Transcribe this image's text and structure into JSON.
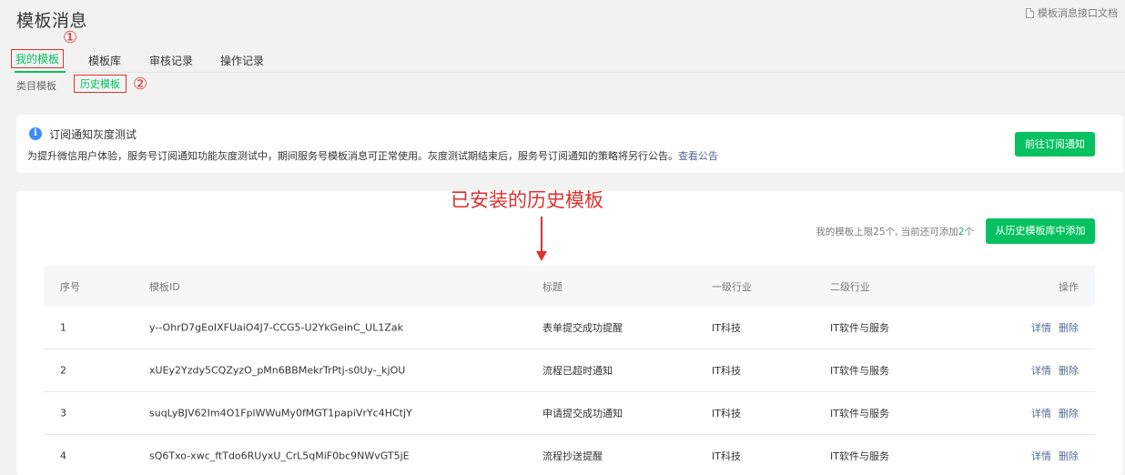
{
  "page_title": "模板消息",
  "doc_link": "模板消息接口文档",
  "tabs": [
    "我的模板",
    "模板库",
    "审核记录",
    "操作记录"
  ],
  "subtabs": [
    "类目模板",
    "历史模板"
  ],
  "markers": [
    "①",
    "②"
  ],
  "notice": {
    "title": "订阅通知灰度测试",
    "desc": "为提升微信用户体验，服务号订阅通知功能灰度测试中，期间服务号模板消息可正常使用。灰度测试期结束后，服务号订阅通知的策略将另行公告。",
    "link": "查看公告",
    "button": "前往订阅通知"
  },
  "annotation": "已安装的历史模板",
  "limit": {
    "prefix": "我的模板上限25个, 当前还可添加",
    "count": "2",
    "suffix": "个"
  },
  "add_button": "从历史模板库中添加",
  "table": {
    "headers": [
      "序号",
      "模板ID",
      "标题",
      "一级行业",
      "二级行业",
      "操作"
    ],
    "rows": [
      {
        "no": "1",
        "id": "y--OhrD7gEoIXFUaiO4J7-CCG5-U2YkGeinC_UL1Zak",
        "title": "表单提交成功提醒",
        "ind1": "IT科技",
        "ind2": "IT软件与服务"
      },
      {
        "no": "2",
        "id": "xUEy2Yzdy5CQZyzO_pMn6BBMekrTrPtj-s0Uy-_kjOU",
        "title": "流程已超时通知",
        "ind1": "IT科技",
        "ind2": "IT软件与服务"
      },
      {
        "no": "3",
        "id": "suqLyBJV62Im4O1FplWWuMy0fMGT1papiVrYc4HCtjY",
        "title": "申请提交成功通知",
        "ind1": "IT科技",
        "ind2": "IT软件与服务"
      },
      {
        "no": "4",
        "id": "sQ6Txo-xwc_ftTdo6RUyxU_CrL5qMiF0bc9NWvGT5jE",
        "title": "流程抄送提醒",
        "ind1": "IT科技",
        "ind2": "IT软件与服务"
      }
    ],
    "op_detail": "详情",
    "op_delete": "删除"
  }
}
